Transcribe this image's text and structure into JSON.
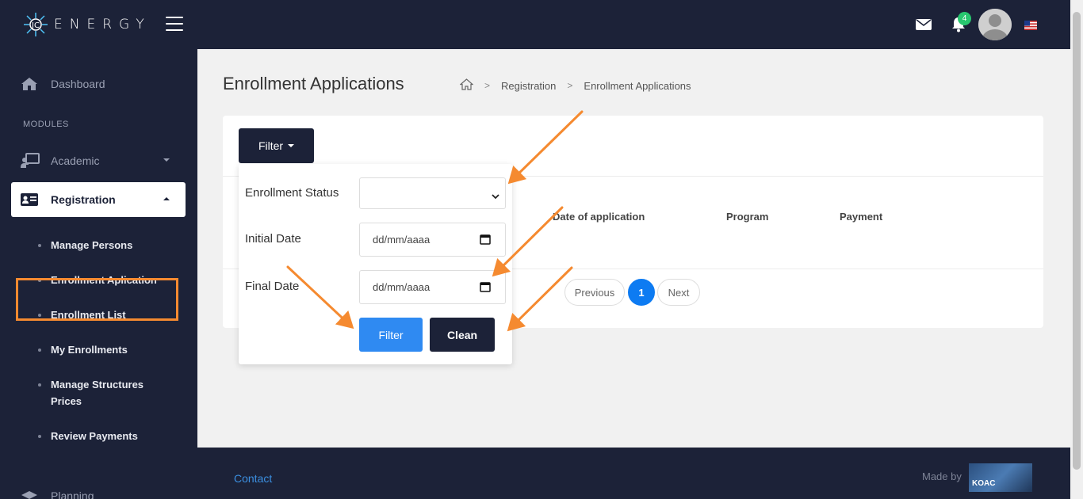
{
  "app": {
    "logo_text": "ENERGY"
  },
  "header": {
    "notifications_count": "4"
  },
  "sidebar": {
    "dashboard": "Dashboard",
    "section": "MODULES",
    "academic": "Academic",
    "registration": "Registration",
    "sub_items": [
      "Manage Persons",
      "Enrollment Aplication",
      "Enrollment List",
      "My Enrollments",
      "Manage Structures Prices",
      "Review Payments"
    ],
    "partial_item": "Planning"
  },
  "page": {
    "title": "Enrollment Applications",
    "breadcrumb": [
      "Registration",
      "Enrollment Applications"
    ]
  },
  "toolbar": {
    "filter_toggle": "Filter"
  },
  "filter_panel": {
    "status_label": "Enrollment Status",
    "status_value": "",
    "initial_label": "Initial Date",
    "initial_placeholder": "dd/mm/aaaa",
    "final_label": "Final Date",
    "final_placeholder": "dd/mm/aaaa",
    "filter_button": "Filter",
    "clean_button": "Clean"
  },
  "table": {
    "columns": [
      "Date of application",
      "Program",
      "Payment"
    ]
  },
  "pagination": {
    "previous": "Previous",
    "current": "1",
    "next": "Next"
  },
  "footer": {
    "contact": "Contact",
    "made_by": "Made by",
    "brand": "KOAC"
  },
  "colors": {
    "navy": "#1c2238",
    "accent_blue": "#2f8af2",
    "annotation_orange": "#f58a30"
  }
}
